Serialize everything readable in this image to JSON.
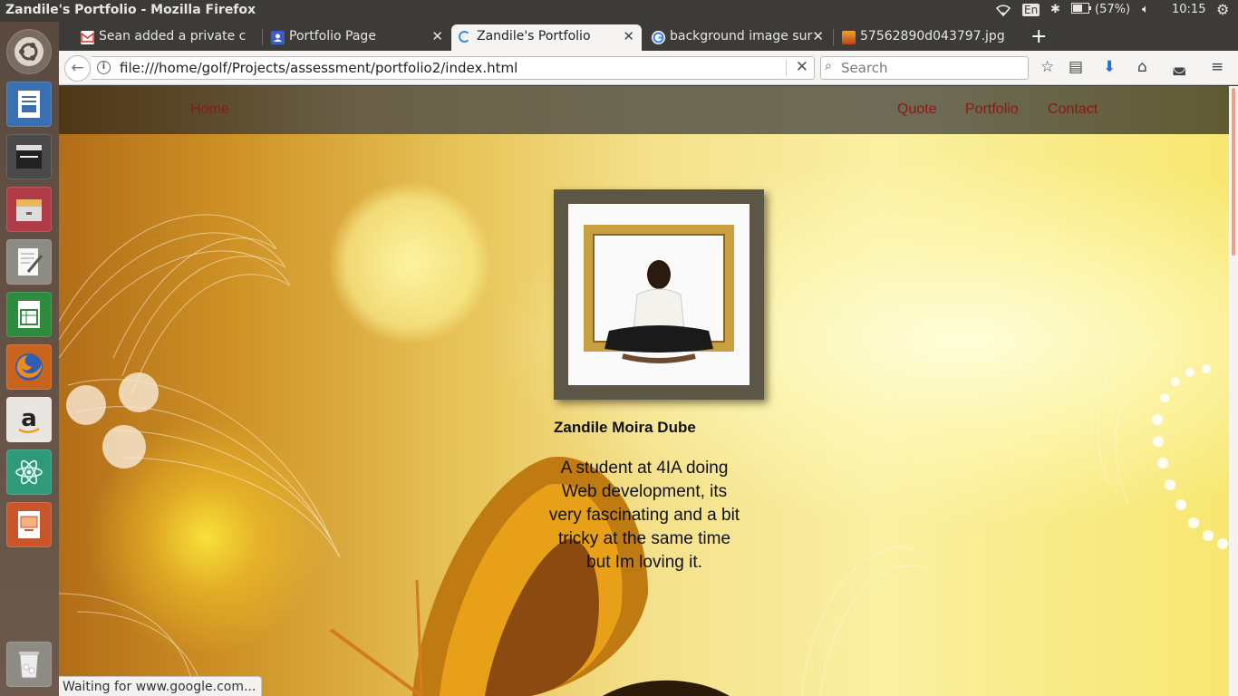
{
  "window": {
    "title": "Zandile's Portfolio - Mozilla Firefox"
  },
  "tray": {
    "keyboard": "En",
    "battery": "(57%)",
    "clock": "10:15"
  },
  "tabs": [
    {
      "label": "Sean added a private c",
      "icon": "gmail-icon"
    },
    {
      "label": "Portfolio Page",
      "icon": "contacts-icon"
    },
    {
      "label": "Zandile's Portfolio",
      "icon": "loading-spinner-icon"
    },
    {
      "label": "background image sur",
      "icon": "google-icon"
    },
    {
      "label": "57562890d043797.jpg",
      "icon": "image-icon"
    }
  ],
  "navbar": {
    "url": "file:///home/golf/Projects/assessment/portfolio2/index.html",
    "search_placeholder": "Search"
  },
  "site": {
    "nav": {
      "home": "Home",
      "quote": "Quote",
      "portfolio": "Portfolio",
      "contact": "Contact"
    },
    "name": "Zandile Moira Dube",
    "bio": "A student at 4IA doing Web development, its very fascinating and a bit tricky at the same time but Im loving it."
  },
  "status": "Waiting for www.google.com...",
  "launcher": [
    "ubuntu-dash-icon",
    "libreoffice-writer-icon",
    "video-editor-icon",
    "file-archive-icon",
    "text-editor-icon",
    "libreoffice-calc-icon",
    "firefox-icon",
    "amazon-icon",
    "atom-icon",
    "libreoffice-impress-icon",
    "trash-icon"
  ],
  "colors": {
    "nav_link": "#8a1a14",
    "frame": "#5c5647"
  }
}
